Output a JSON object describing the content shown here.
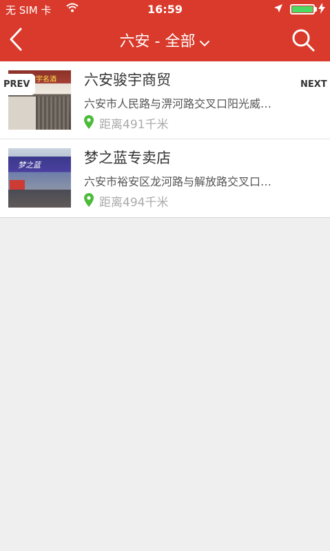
{
  "status_bar": {
    "carrier": "无 SIM 卡",
    "time": "16:59"
  },
  "nav": {
    "title": "六安 - 全部",
    "back_icon": "chevron-left-icon",
    "search_icon": "search-icon"
  },
  "pager": {
    "prev_label": "PREV",
    "next_label": "NEXT"
  },
  "stores": [
    {
      "name": "六安骏宇商贸",
      "address": "六安市人民路与淠河路交叉口阳光威…",
      "distance": "距离491千米",
      "thumb_sign": "骏宇名酒"
    },
    {
      "name": "梦之蓝专卖店",
      "address": "六安市裕安区龙河路与解放路交叉口…",
      "distance": "距离494千米",
      "thumb_sign": "梦之蓝"
    }
  ],
  "colors": {
    "brand": "#d93a2b",
    "pin": "#4cbb3a",
    "background": "#efefef"
  }
}
